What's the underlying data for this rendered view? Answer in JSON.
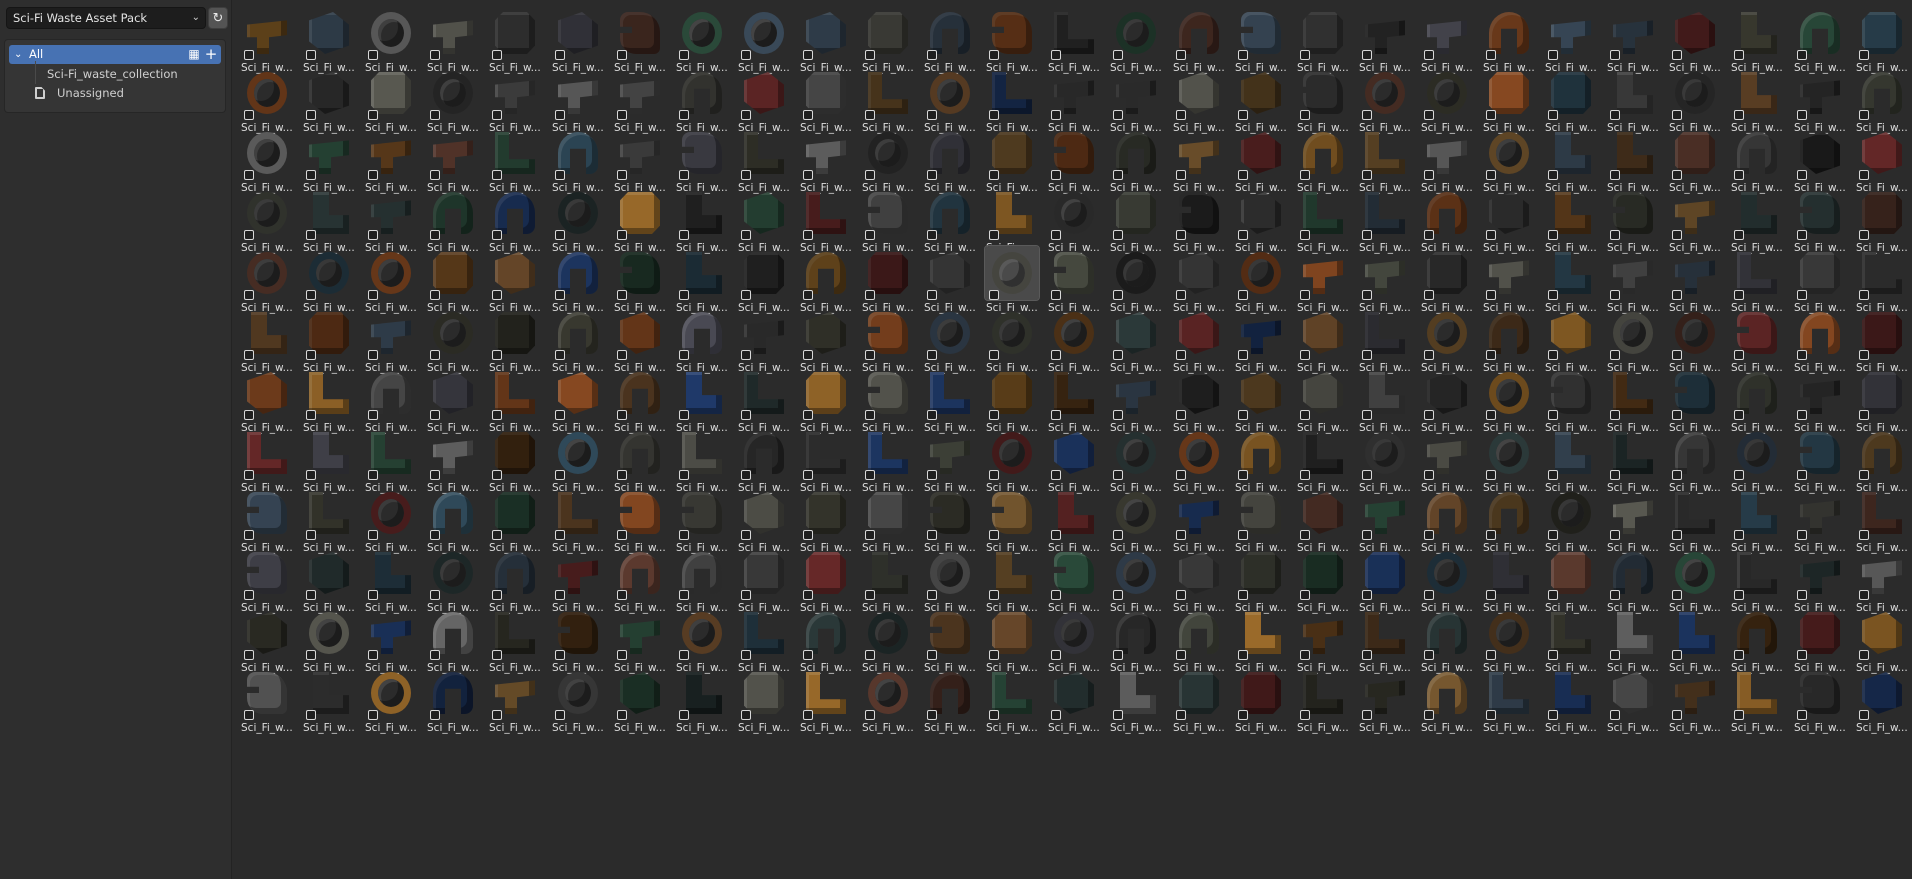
{
  "library_selector": {
    "value": "Sci-Fi Waste Asset Pack",
    "chevron": "chevron-down-icon"
  },
  "refresh_button": {
    "icon": "refresh-icon"
  },
  "catalogs": {
    "all": {
      "label": "All"
    },
    "collection": {
      "label": "Sci-Fi_waste_collection"
    },
    "unassigned": {
      "label": "Unassigned"
    }
  },
  "grid": {
    "item_label": "Sci_Fi_w...",
    "rows": 12,
    "columns": 27,
    "selected_item": {
      "row": 4,
      "column": 12
    }
  },
  "colors": {
    "accent": "#4772b3",
    "background": "#2b2b2b",
    "panel": "#353535",
    "asset_palette": [
      "#6b4a2b",
      "#3b3b3b",
      "#4a4a4a",
      "#7a5a30",
      "#2c3a3a",
      "#5a5a52",
      "#8a4a22",
      "#2d2d2d",
      "#3a4a5a",
      "#5c3a2e",
      "#474a40",
      "#9a6a2a",
      "#2f4a5a",
      "#4e4e58",
      "#6a2a2a",
      "#3a3a30",
      "#1f3a6a",
      "#6a6a6a",
      "#2a4a3a",
      "#5a3a1a"
    ]
  }
}
